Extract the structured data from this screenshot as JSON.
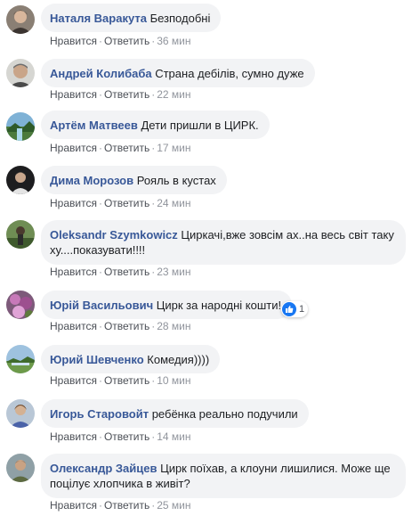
{
  "labels": {
    "like": "Нравится",
    "reply": "Ответить",
    "separator": "·"
  },
  "comments": [
    {
      "author": "Наталя Варакута",
      "text": "Безподобні",
      "time": "36 мин"
    },
    {
      "author": "Андрей Колибаба",
      "text": "Страна дебілів, сумно дуже",
      "time": "22 мин"
    },
    {
      "author": "Артём Матвеев",
      "text": "Дети пришли в ЦИРК.",
      "time": "17 мин"
    },
    {
      "author": "Дима Морозов",
      "text": "Рояль в кустах",
      "time": "24 мин"
    },
    {
      "author": "Oleksandr Szymkowicz",
      "text": "Циркачі,вже зовсім ах..на весь світ таку",
      "text_line2": "ху....показувати!!!!",
      "time": "23 мин"
    },
    {
      "author": "Юрій Васильович",
      "text": "Цирк за народні кошти!",
      "time": "28 мин",
      "reactions": {
        "icon": "thumbs-up-icon",
        "count": "1"
      }
    },
    {
      "author": "Юрий Шевченко",
      "text": "Комедия))))",
      "time": "10 мин"
    },
    {
      "author": "Игорь Старовойт",
      "text": "ребёнка реально подучили",
      "time": "14 мин"
    },
    {
      "author": "Олександр Зайцев",
      "text": "Цирк поїхав, а клоуни лишилися. Може ще",
      "text_line2": "поцілує хлопчика в живіт?",
      "time": "25 мин"
    }
  ],
  "colors": {
    "author": "#385898",
    "bubble": "#f2f3f5",
    "action": "#4b4f56",
    "meta": "#90949c",
    "like": "#1877f2"
  }
}
